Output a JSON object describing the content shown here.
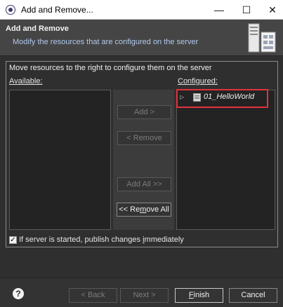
{
  "window": {
    "title": "Add and Remove..."
  },
  "header": {
    "title": "Add and Remove",
    "description": "Modify the resources that are configured on the server"
  },
  "instructions": "Move resources to the right to configure them on the server",
  "available": {
    "label": "Available:"
  },
  "configured": {
    "label": "Configured:",
    "items": [
      {
        "name": "01_HelloWorld"
      }
    ]
  },
  "buttons": {
    "add": "Add >",
    "remove": "< Remove",
    "add_all": "Add All >>",
    "remove_all_prefix": "<< Re",
    "remove_all_mnemonic": "m",
    "remove_all_suffix": "ove All"
  },
  "publish": {
    "checked": true,
    "label_prefix": "If server is started, publish changes ",
    "label_mnemonic": "i",
    "label_suffix": "mmediately"
  },
  "footer": {
    "help": "?",
    "back": "< Back",
    "next": "Next >",
    "finish_mnemonic": "F",
    "finish_rest": "inish",
    "cancel": "Cancel"
  },
  "colors": {
    "accent_highlight": "#e3313b",
    "header_desc": "#b0c9ec"
  }
}
